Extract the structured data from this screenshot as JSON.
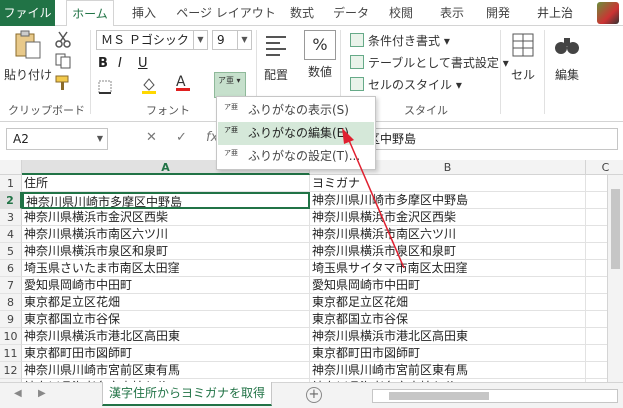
{
  "tabs": {
    "file": "ファイル",
    "home": "ホーム",
    "insert": "挿入",
    "page_layout": "ページ レイアウト",
    "formulas": "数式",
    "data": "データ",
    "review": "校閲",
    "view": "表示",
    "developer": "開発",
    "user": "井上治"
  },
  "ribbon": {
    "paste": "貼り付け",
    "clipboard": "クリップボード",
    "font_name": "ＭＳ Ｐゴシック",
    "font_size": "9",
    "font": "フォント",
    "align": "配置",
    "number": "数値",
    "cond_format": "条件付き書式",
    "table_format": "テーブルとして書式設定",
    "cell_style": "セルのスタイル",
    "style": "スタイル",
    "cells": "セル",
    "editing": "編集",
    "bold": "B",
    "italic": "I",
    "underline": "U",
    "font_a": "A",
    "phonetic_glyph": "ア亜",
    "percent": "%",
    "accent_color": "#217346"
  },
  "menu": {
    "show": "ふりがなの表示(S)",
    "edit": "ふりがなの編集(E)",
    "settings": "ふりがなの設定(T)..."
  },
  "formula_bar": {
    "name_box": "A2",
    "formula": "区中野島"
  },
  "grid": {
    "columns": [
      "A",
      "B",
      "C"
    ],
    "rows": [
      {
        "num": "1",
        "a": "住所",
        "b": "ヨミガナ"
      },
      {
        "num": "2",
        "a": "神奈川県川崎市多摩区中野島",
        "b": "神奈川県川崎市多摩区中野島"
      },
      {
        "num": "3",
        "a": "神奈川県横浜市金沢区西柴",
        "b": "神奈川県横浜市金沢区西柴"
      },
      {
        "num": "4",
        "a": "神奈川県横浜市南区六ツ川",
        "b": "神奈川県横浜市南区六ツ川"
      },
      {
        "num": "5",
        "a": "神奈川県横浜市泉区和泉町",
        "b": "神奈川県横浜市泉区和泉町"
      },
      {
        "num": "6",
        "a": "埼玉県さいたま市南区太田窪",
        "b": "埼玉県サイタマ市南区太田窪"
      },
      {
        "num": "7",
        "a": "愛知県岡崎市中田町",
        "b": "愛知県岡崎市中田町"
      },
      {
        "num": "8",
        "a": "東京都足立区花畑",
        "b": "東京都足立区花畑"
      },
      {
        "num": "9",
        "a": "東京都国立市谷保",
        "b": "東京都国立市谷保"
      },
      {
        "num": "10",
        "a": "神奈川県横浜市港北区高田東",
        "b": "神奈川県横浜市港北区高田東"
      },
      {
        "num": "11",
        "a": "東京都町田市図師町",
        "b": "東京都町田市図師町"
      },
      {
        "num": "12",
        "a": "神奈川県川崎市宮前区東有馬",
        "b": "神奈川県川崎市宮前区東有馬"
      },
      {
        "num": "13",
        "a": "神奈川県海老名市東柏ケ谷",
        "b": "神奈川県海老名市東柏ケ谷"
      },
      {
        "num": "14",
        "a": "神奈川県横浜市緑区西八朔町",
        "b": "神奈川県横浜市緑区西八朔町"
      }
    ]
  },
  "sheet": {
    "tab": "漢字住所からヨミガナを取得",
    "add": "+"
  }
}
